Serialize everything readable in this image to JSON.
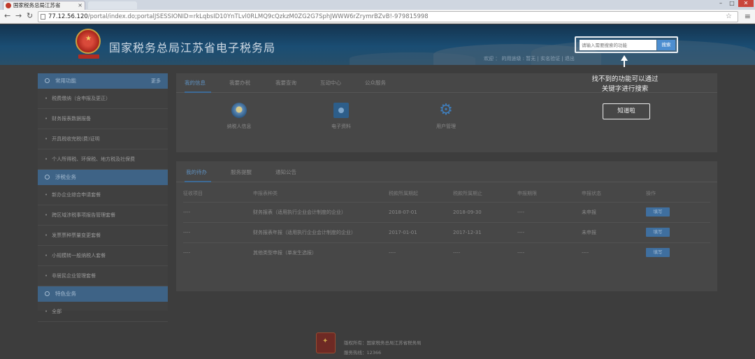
{
  "browser": {
    "tab_title": "国家税务总局江苏省",
    "url_host": "77.12.56.120",
    "url_path": "/portal/index.do;portalJSESSIONID=rkLqbsID10YnTLvl0RLMQ9cQzkzM0ZG2G7SphJWWW6rZrymrBZvB!-979815998"
  },
  "header": {
    "site_title": "国家税务总局江苏省电子税务局",
    "search_placeholder": "请输入需要搜索的功能",
    "search_button": "搜索",
    "links": "欢迎 ：                             的用途级 : 暂无 | 实名验证 | 退出"
  },
  "sidebar": {
    "section1": {
      "title": "常用功能",
      "more": "更多"
    },
    "section1_items": [
      "税费缴纳（含申报及更正）",
      "财务报表数据报备",
      "开具税收完税(费)证明",
      "个人所得税、环保税、地方税及社保费"
    ],
    "section2": {
      "title": "涉税业务"
    },
    "section2_items": [
      "新办企业综合申请套餐",
      "跨区域涉税事项报告管理套餐",
      "发票票种票量变更套餐",
      "小规模转一般纳税人套餐",
      "非居民企业管理套餐"
    ],
    "section3": {
      "title": "特色业务"
    },
    "section3_items": [
      "全部"
    ]
  },
  "main_top": {
    "tabs": [
      "我的信息",
      "我要办税",
      "我要查询",
      "互动中心",
      "公众服务"
    ],
    "functions": [
      {
        "label": "纳税人信息",
        "icon": "lightbulb-icon"
      },
      {
        "label": "电子资料",
        "icon": "folder-icon"
      },
      {
        "label": "用户管理",
        "icon": "gear-icon"
      }
    ]
  },
  "main_bottom": {
    "tabs": [
      "我的待办",
      "服务提醒",
      "通知公告"
    ],
    "columns": [
      "征收项目",
      "申报表种类",
      "税款所属期起",
      "税款所属期止",
      "申报期限",
      "申报状态",
      "操作"
    ],
    "rows": [
      [
        "----",
        "财务报表（适用执行企业会计制度的企业）",
        "2018-07-01",
        "2018-09-30",
        "----",
        "未申报",
        "填写"
      ],
      [
        "----",
        "财务报表年报（适用执行企业会计制度的企业）",
        "2017-01-01",
        "2017-12-31",
        "----",
        "未申报",
        "填写"
      ],
      [
        "----",
        "其他类型申报（单发生选报）",
        "----",
        "----",
        "----",
        "----",
        "填写"
      ]
    ]
  },
  "footer": {
    "line1": "版权所有：国家税务总局江苏省税务局",
    "line2": "服务热线：12366"
  },
  "overlay": {
    "hint_line1": "找不到的功能可以通过",
    "hint_line2": "关键字进行搜索",
    "button": "知道啦"
  },
  "colors": {
    "accent": "#4d8ed0",
    "header_bg": "#1a4d73",
    "overlay_dim": "#3d3d3d"
  }
}
